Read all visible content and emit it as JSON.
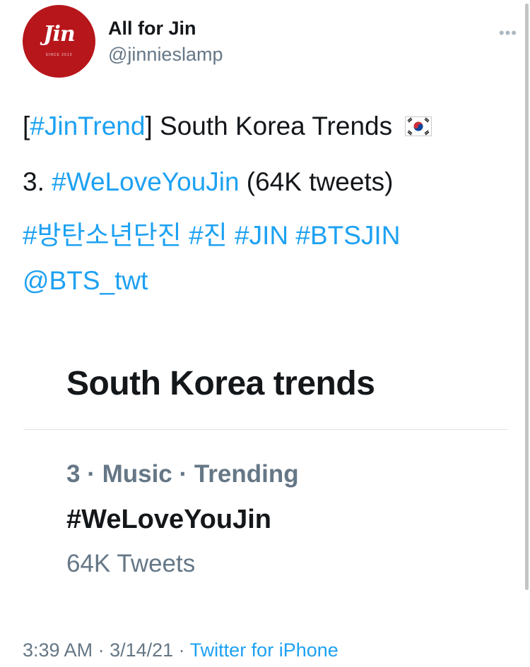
{
  "author": {
    "display_name": "All for Jin",
    "handle": "@jinnieslamp",
    "avatar_logo_text": "Jin",
    "avatar_logo_subtext": "SINCE 2013"
  },
  "tweet": {
    "line1_bracket_open": "[",
    "line1_hashtag": "#JinTrend",
    "line1_bracket_close": "]",
    "line1_text": " South Korea Trends",
    "line2_rank": "3. ",
    "line2_hashtag": "#WeLoveYouJin",
    "line2_count": " (64K tweets)",
    "line3_tags": [
      "#방탄소년단진",
      "#진",
      "#JIN",
      "#BTSJIN"
    ],
    "line4_mention": "@BTS_twt"
  },
  "card": {
    "title": "South Korea trends",
    "trend_meta": "3 · Music · Trending",
    "trend_name": "#WeLoveYouJin",
    "trend_count": "64K Tweets"
  },
  "footer": {
    "time": "3:39 AM",
    "date": "3/14/21",
    "separator": " · ",
    "source": "Twitter for iPhone"
  },
  "colors": {
    "link": "#1da1f2",
    "secondary_text": "#657786",
    "avatar_bg": "#b7161b"
  },
  "icons": {
    "flag": "south-korea-flag-icon",
    "more": "more-dots-icon"
  }
}
